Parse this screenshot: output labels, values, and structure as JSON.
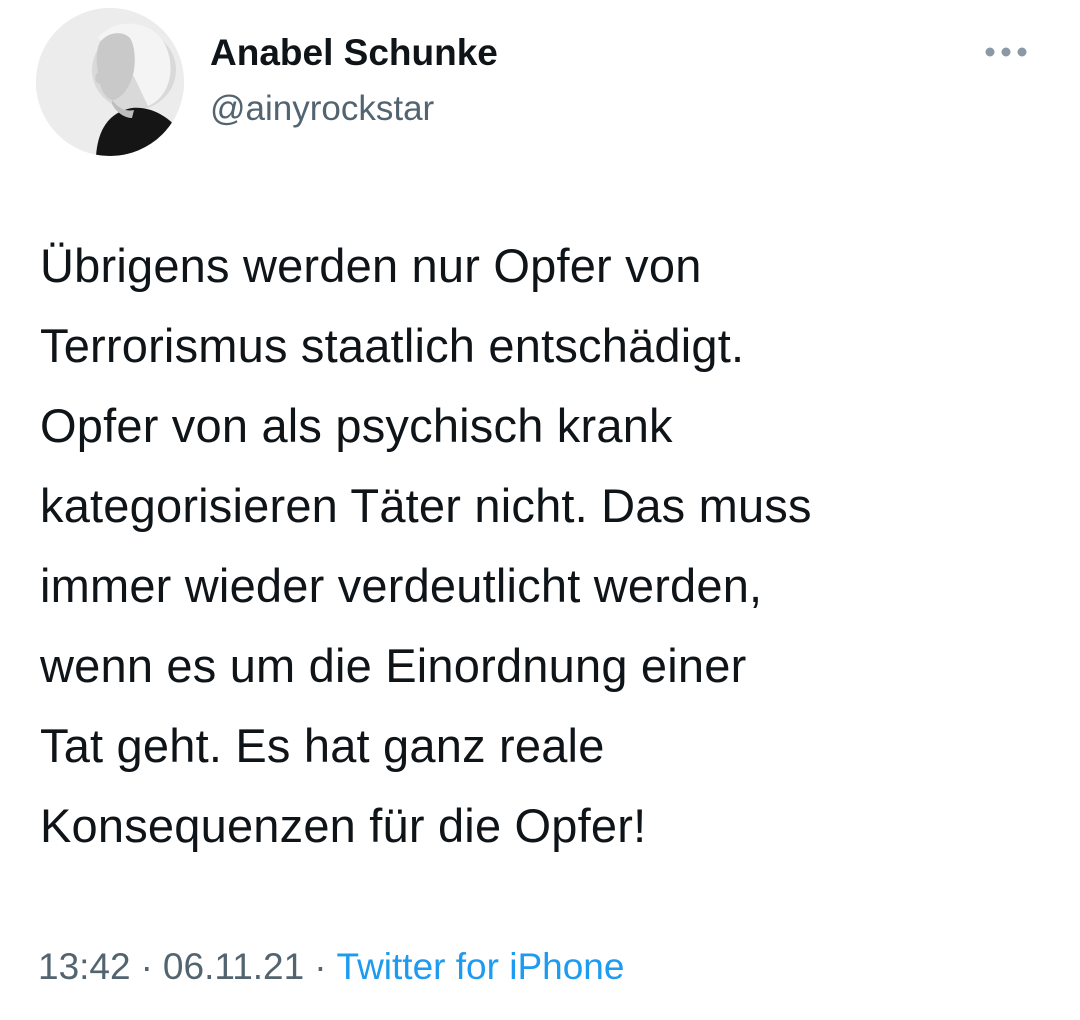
{
  "user": {
    "display_name": "Anabel Schunke",
    "handle": "@ainyrockstar",
    "avatar_icon": "user-avatar-photo"
  },
  "tweet": {
    "text": "Übrigens werden nur Opfer von\nTerrorismus staatlich entschädigt.\nOpfer von als psychisch krank\nkategorisieren Täter nicht. Das muss\nimmer wieder verdeutlicht werden,\nwenn es um die Einordnung einer\nTat geht. Es hat ganz reale\nKonsequenzen für die Opfer!",
    "time": "13:42",
    "separator": "·",
    "date": "06.11.21",
    "source": "Twitter for iPhone"
  },
  "icons": {
    "more": "more-options-icon"
  },
  "colors": {
    "text": "#0f1419",
    "secondary": "#536471",
    "link": "#1d9bf0",
    "background": "#ffffff"
  }
}
